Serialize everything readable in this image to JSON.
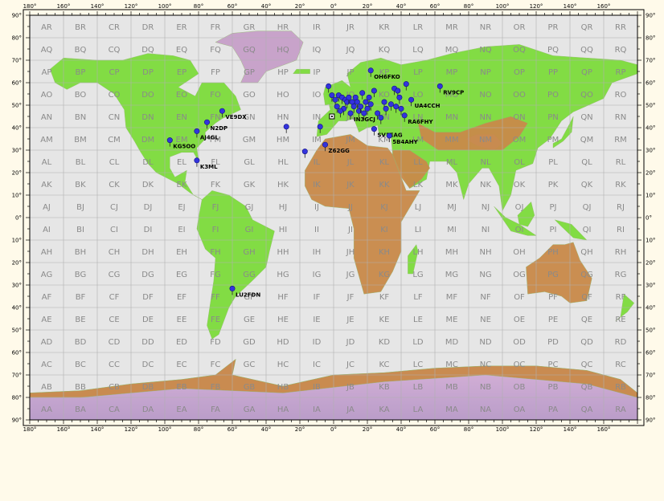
{
  "map": {
    "colors": {
      "ocean": "#e6e6e6",
      "lowland": "#7ddc3c",
      "upland": "#c98a4a",
      "ice": "#c7a0c9",
      "grid": "#b0b0b0",
      "marker": "#3333dd",
      "frame": "#000000",
      "background": "#fffaea"
    },
    "x_ticks": [
      {
        "value": -180,
        "label": "180°"
      },
      {
        "value": -160,
        "label": "160°"
      },
      {
        "value": -140,
        "label": "140°"
      },
      {
        "value": -120,
        "label": "120°"
      },
      {
        "value": -100,
        "label": "100°"
      },
      {
        "value": -80,
        "label": "80°"
      },
      {
        "value": -60,
        "label": "60°"
      },
      {
        "value": -40,
        "label": "40°"
      },
      {
        "value": -20,
        "label": "20°"
      },
      {
        "value": 0,
        "label": "0°"
      },
      {
        "value": 20,
        "label": "20°"
      },
      {
        "value": 40,
        "label": "40°"
      },
      {
        "value": 60,
        "label": "60°"
      },
      {
        "value": 80,
        "label": "80°"
      },
      {
        "value": 100,
        "label": "100°"
      },
      {
        "value": 120,
        "label": "120°"
      },
      {
        "value": 140,
        "label": "140°"
      },
      {
        "value": 160,
        "label": "160°"
      }
    ],
    "y_ticks": [
      {
        "value": 90,
        "label": "90°"
      },
      {
        "value": 80,
        "label": "80°"
      },
      {
        "value": 70,
        "label": "70°"
      },
      {
        "value": 60,
        "label": "60°"
      },
      {
        "value": 50,
        "label": "50°"
      },
      {
        "value": 40,
        "label": "40°"
      },
      {
        "value": 30,
        "label": "30°"
      },
      {
        "value": 20,
        "label": "20°"
      },
      {
        "value": 10,
        "label": "10°"
      },
      {
        "value": 0,
        "label": "0°"
      },
      {
        "value": -10,
        "label": "10°"
      },
      {
        "value": -20,
        "label": "20°"
      },
      {
        "value": -30,
        "label": "30°"
      },
      {
        "value": -40,
        "label": "40°"
      },
      {
        "value": -50,
        "label": "50°"
      },
      {
        "value": -60,
        "label": "60°"
      },
      {
        "value": -70,
        "label": "70°"
      },
      {
        "value": -80,
        "label": "80°"
      },
      {
        "value": -90,
        "label": "90°"
      }
    ],
    "grid_squares": [
      [
        "AR",
        "BR",
        "CR",
        "DR",
        "ER",
        "FR",
        "GR",
        "HR",
        "IR",
        "JR",
        "KR",
        "LR",
        "MR",
        "NR",
        "OR",
        "PR",
        "QR",
        "RR"
      ],
      [
        "AQ",
        "BQ",
        "CQ",
        "DQ",
        "EQ",
        "FQ",
        "GQ",
        "HQ",
        "IQ",
        "JQ",
        "KQ",
        "LQ",
        "MQ",
        "NQ",
        "OQ",
        "PQ",
        "QQ",
        "RQ"
      ],
      [
        "AP",
        "BP",
        "CP",
        "DP",
        "EP",
        "FP",
        "GP",
        "HP",
        "IP",
        "JP",
        "KP",
        "LP",
        "MP",
        "NP",
        "OP",
        "PP",
        "QP",
        "RP"
      ],
      [
        "AO",
        "BO",
        "CO",
        "DO",
        "EO",
        "FO",
        "GO",
        "HO",
        "IO",
        "JO",
        "KO",
        "LO",
        "MO",
        "NO",
        "OO",
        "PO",
        "QO",
        "RO"
      ],
      [
        "AN",
        "BN",
        "CN",
        "DN",
        "EN",
        "FN",
        "GN",
        "HN",
        "IN",
        "JN",
        "KN",
        "LN",
        "MN",
        "NN",
        "ON",
        "PN",
        "QN",
        "RN"
      ],
      [
        "AM",
        "BM",
        "CM",
        "DM",
        "EM",
        "FM",
        "GM",
        "HM",
        "IM",
        "JM",
        "KM",
        "LM",
        "MM",
        "NM",
        "OM",
        "PM",
        "QM",
        "RM"
      ],
      [
        "AL",
        "BL",
        "CL",
        "DL",
        "EL",
        "FL",
        "GL",
        "HL",
        "IL",
        "JL",
        "KL",
        "LL",
        "ML",
        "NL",
        "OL",
        "PL",
        "QL",
        "RL"
      ],
      [
        "AK",
        "BK",
        "CK",
        "DK",
        "EK",
        "FK",
        "GK",
        "HK",
        "IK",
        "JK",
        "KK",
        "LK",
        "MK",
        "NK",
        "OK",
        "PK",
        "QK",
        "RK"
      ],
      [
        "AJ",
        "BJ",
        "CJ",
        "DJ",
        "EJ",
        "FJ",
        "GJ",
        "HJ",
        "IJ",
        "JJ",
        "KJ",
        "LJ",
        "MJ",
        "NJ",
        "OJ",
        "PJ",
        "QJ",
        "RJ"
      ],
      [
        "AI",
        "BI",
        "CI",
        "DI",
        "EI",
        "FI",
        "GI",
        "HI",
        "II",
        "JI",
        "KI",
        "LI",
        "MI",
        "NI",
        "OI",
        "PI",
        "QI",
        "RI"
      ],
      [
        "AH",
        "BH",
        "CH",
        "DH",
        "EH",
        "FH",
        "GH",
        "HH",
        "IH",
        "JH",
        "KH",
        "LH",
        "MH",
        "NH",
        "OH",
        "PH",
        "QH",
        "RH"
      ],
      [
        "AG",
        "BG",
        "CG",
        "DG",
        "EG",
        "FG",
        "GG",
        "HG",
        "IG",
        "JG",
        "KG",
        "LG",
        "MG",
        "NG",
        "OG",
        "PG",
        "QG",
        "RG"
      ],
      [
        "AF",
        "BF",
        "CF",
        "DF",
        "EF",
        "FF",
        "GF",
        "HF",
        "IF",
        "JF",
        "KF",
        "LF",
        "MF",
        "NF",
        "OF",
        "PF",
        "QF",
        "RF"
      ],
      [
        "AE",
        "BE",
        "CE",
        "DE",
        "EE",
        "FE",
        "GE",
        "HE",
        "IE",
        "JE",
        "KE",
        "LE",
        "ME",
        "NE",
        "OE",
        "PE",
        "QE",
        "RE"
      ],
      [
        "AD",
        "BD",
        "CD",
        "DD",
        "ED",
        "FD",
        "GD",
        "HD",
        "ID",
        "JD",
        "KD",
        "LD",
        "MD",
        "ND",
        "OD",
        "PD",
        "QD",
        "RD"
      ],
      [
        "AC",
        "BC",
        "CC",
        "DC",
        "EC",
        "FC",
        "GC",
        "HC",
        "IC",
        "JC",
        "KC",
        "LC",
        "MC",
        "NC",
        "OC",
        "PC",
        "QC",
        "RC"
      ],
      [
        "AB",
        "BB",
        "CB",
        "DB",
        "EB",
        "FB",
        "GB",
        "HB",
        "IB",
        "JB",
        "KB",
        "LB",
        "MB",
        "NB",
        "OB",
        "PB",
        "QB",
        "RB"
      ],
      [
        "AA",
        "BA",
        "CA",
        "DA",
        "EA",
        "FA",
        "GA",
        "HA",
        "IA",
        "JA",
        "KA",
        "LA",
        "MA",
        "NA",
        "OA",
        "PA",
        "QA",
        "RA"
      ]
    ],
    "stations": [
      {
        "call": "VE9DX",
        "lon": -66,
        "lat": 46
      },
      {
        "call": "N2DP",
        "lon": -75,
        "lat": 41
      },
      {
        "call": "AJ4GL",
        "lon": -81,
        "lat": 37
      },
      {
        "call": "KG5OO",
        "lon": -97,
        "lat": 33
      },
      {
        "call": "K3ML",
        "lon": -81,
        "lat": 24
      },
      {
        "call": "LU2FDN",
        "lon": -60,
        "lat": -33
      },
      {
        "call": "OH6FKO",
        "lon": 22,
        "lat": 64
      },
      {
        "call": "RV9CP",
        "lon": 63,
        "lat": 57
      },
      {
        "call": "UA4CCH",
        "lon": 46,
        "lat": 51
      },
      {
        "call": "IN3GCJ",
        "lon": 10,
        "lat": 45
      },
      {
        "call": "RA6FHY",
        "lon": 42,
        "lat": 44
      },
      {
        "call": "SV1EAG",
        "lon": 24,
        "lat": 38
      },
      {
        "call": "5B4AHY",
        "lon": 33,
        "lat": 35
      },
      {
        "call": "Z62GG",
        "lon": -5,
        "lat": 31
      },
      {
        "call": "",
        "lon": -28,
        "lat": 39
      },
      {
        "call": "",
        "lon": -17,
        "lat": 28
      },
      {
        "call": "",
        "lon": -8,
        "lat": 39
      },
      {
        "call": "",
        "lon": -3,
        "lat": 57
      },
      {
        "call": "",
        "lon": -1,
        "lat": 53
      },
      {
        "call": "",
        "lon": 1,
        "lat": 51
      },
      {
        "call": "",
        "lon": 3,
        "lat": 53
      },
      {
        "call": "",
        "lon": 5,
        "lat": 52
      },
      {
        "call": "",
        "lon": 7,
        "lat": 51
      },
      {
        "call": "",
        "lon": 8,
        "lat": 50
      },
      {
        "call": "",
        "lon": 9,
        "lat": 52
      },
      {
        "call": "",
        "lon": 11,
        "lat": 50
      },
      {
        "call": "",
        "lon": 12,
        "lat": 48
      },
      {
        "call": "",
        "lon": 13,
        "lat": 52
      },
      {
        "call": "",
        "lon": 14,
        "lat": 50
      },
      {
        "call": "",
        "lon": 15,
        "lat": 46
      },
      {
        "call": "",
        "lon": 16,
        "lat": 48
      },
      {
        "call": "",
        "lon": 17,
        "lat": 54
      },
      {
        "call": "",
        "lon": 18,
        "lat": 45
      },
      {
        "call": "",
        "lon": 19,
        "lat": 50
      },
      {
        "call": "",
        "lon": 20,
        "lat": 47
      },
      {
        "call": "",
        "lon": 21,
        "lat": 52
      },
      {
        "call": "",
        "lon": 22,
        "lat": 49
      },
      {
        "call": "",
        "lon": 6,
        "lat": 47
      },
      {
        "call": "",
        "lon": 4,
        "lat": 46
      },
      {
        "call": "",
        "lon": 2,
        "lat": 48
      },
      {
        "call": "",
        "lon": 26,
        "lat": 45
      },
      {
        "call": "",
        "lon": 30,
        "lat": 50
      },
      {
        "call": "",
        "lon": 31,
        "lat": 47
      },
      {
        "call": "",
        "lon": 34,
        "lat": 49
      },
      {
        "call": "",
        "lon": 36,
        "lat": 56
      },
      {
        "call": "",
        "lon": 38,
        "lat": 55
      },
      {
        "call": "",
        "lon": 37,
        "lat": 48
      },
      {
        "call": "",
        "lon": 39,
        "lat": 52
      },
      {
        "call": "",
        "lon": 40,
        "lat": 47
      },
      {
        "call": "",
        "lon": 43,
        "lat": 58
      },
      {
        "call": "",
        "lon": 28,
        "lat": 43
      },
      {
        "call": "",
        "lon": 24,
        "lat": 55
      }
    ],
    "square_marker": {
      "lon": -1,
      "lat": 45
    }
  }
}
